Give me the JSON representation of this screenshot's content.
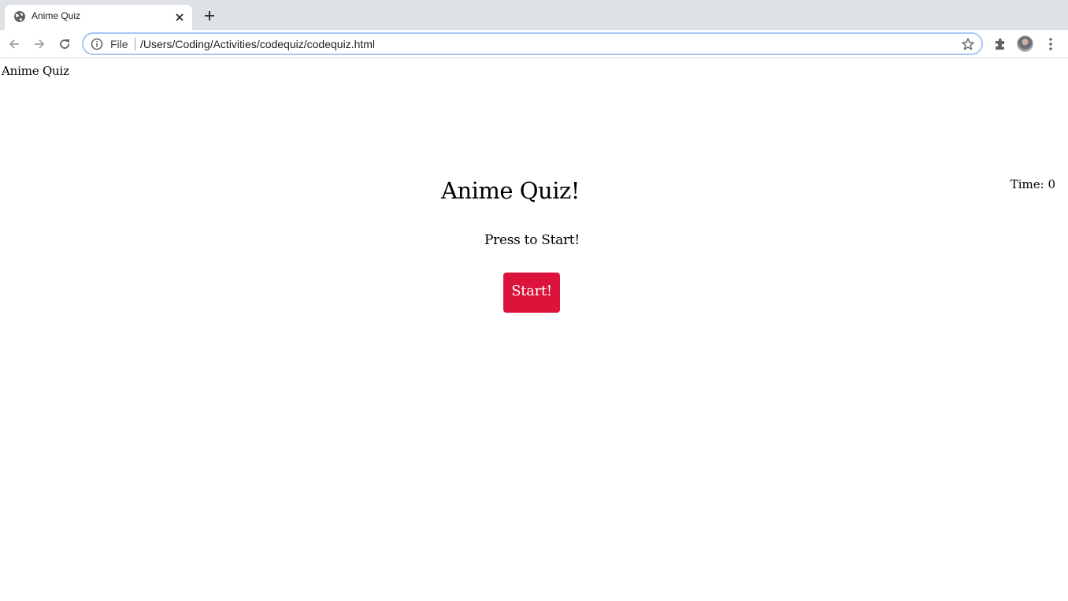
{
  "browser": {
    "tab": {
      "title": "Anime Quiz",
      "favicon": "globe-icon"
    },
    "omnibox": {
      "scheme_label": "File",
      "url": "/Users/Coding/Activities/codequiz/codequiz.html"
    }
  },
  "page": {
    "header_title": "Anime Quiz",
    "timer_text": "Time: 0",
    "quiz_title": "Anime Quiz!",
    "prompt": "Press to Start!",
    "start_button_label": "Start!"
  },
  "colors": {
    "start_button": "#dc143c",
    "tabstrip": "#dee1e6",
    "omnibox_focus": "#a8c7fa"
  }
}
